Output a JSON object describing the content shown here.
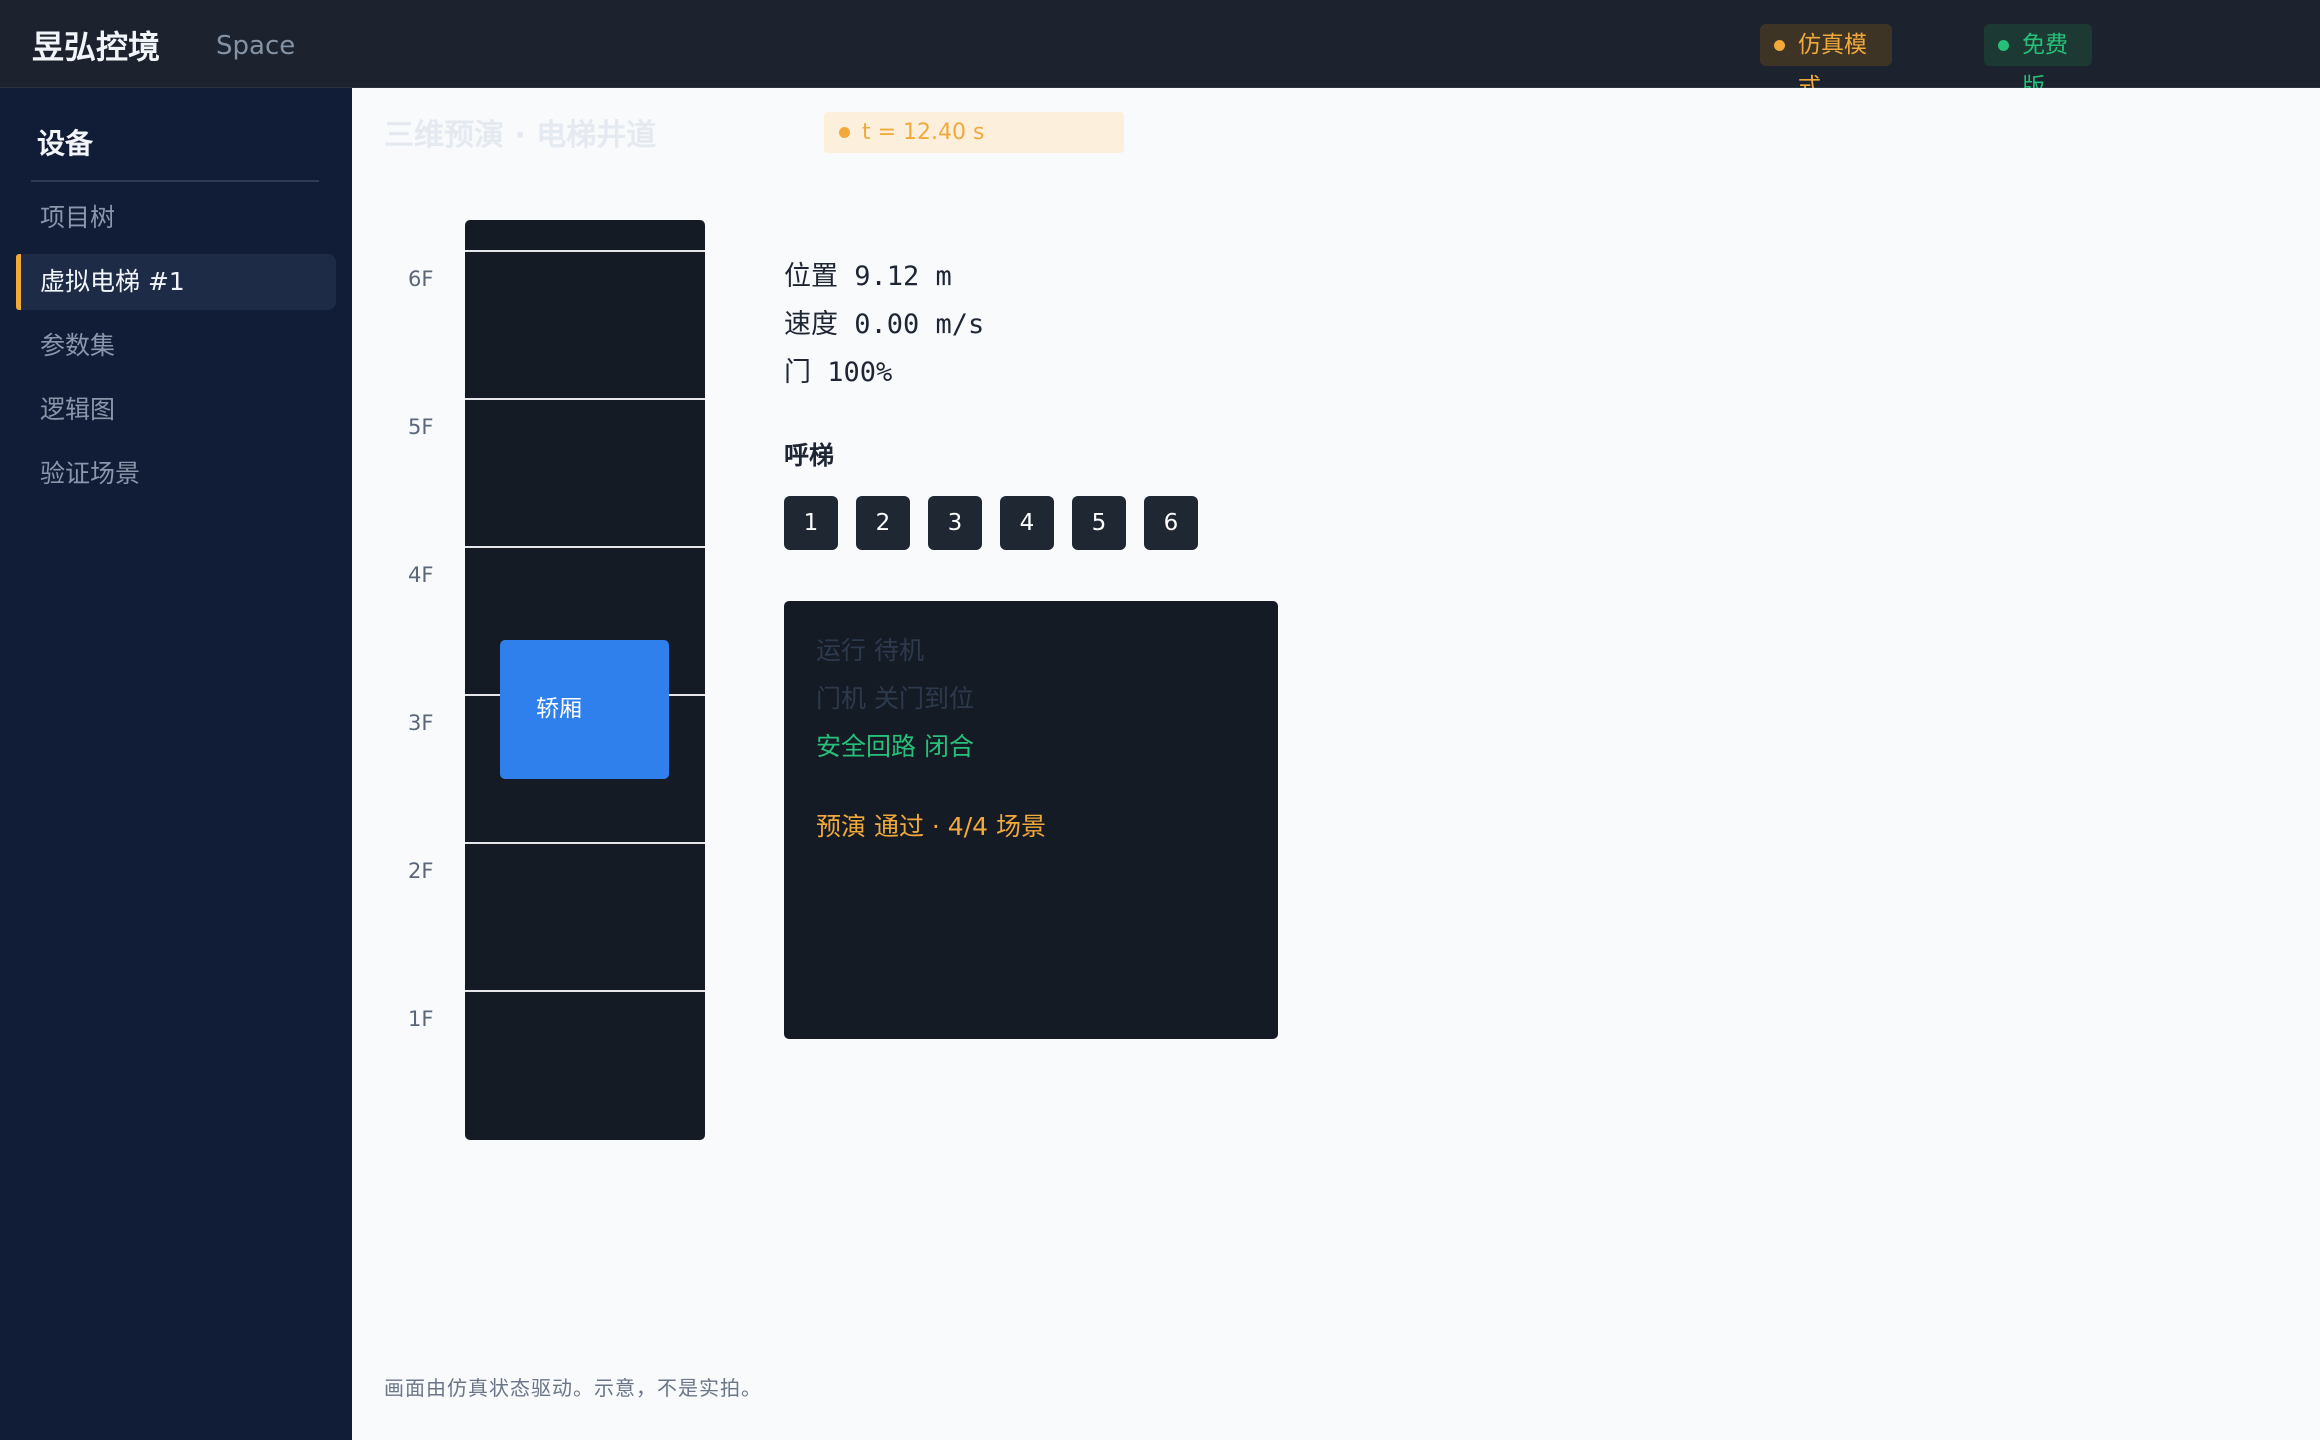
{
  "header": {
    "brand": "昱弘控境",
    "workspace": "Space",
    "sim_badge": "仿真模式",
    "plan_badge": "免费版"
  },
  "sidebar": {
    "title": "设备",
    "items": [
      {
        "label": "项目树"
      },
      {
        "label": "虚拟电梯 #1",
        "active": true
      },
      {
        "label": "参数集"
      },
      {
        "label": "逻辑图"
      },
      {
        "label": "验证场景"
      }
    ]
  },
  "main": {
    "title": "三维预演 · 电梯井道",
    "time": "t = 12.40 s",
    "shaft": {
      "floors": [
        "6F",
        "5F",
        "4F",
        "3F",
        "2F",
        "1F"
      ],
      "car_label": "轿厢"
    },
    "readouts": {
      "position": "位置 9.12 m",
      "speed": "速度 0.00 m/s",
      "door": "门 100%"
    },
    "call": {
      "title": "呼梯",
      "buttons": [
        "1",
        "2",
        "3",
        "4",
        "5",
        "6"
      ]
    },
    "log": {
      "run": "运行 待机",
      "door": "门机 关门到位",
      "safety": "安全回路 闭合",
      "result": "预演 通过 · 4/4 场景"
    },
    "footnote": "画面由仿真状态驱动。示意，不是实拍。"
  },
  "colors": {
    "accent": "#f2a93b",
    "success": "#27c07a",
    "car": "#2f80ec",
    "sidebar_bg": "#111c36",
    "topbar_bg": "#1c232e"
  }
}
